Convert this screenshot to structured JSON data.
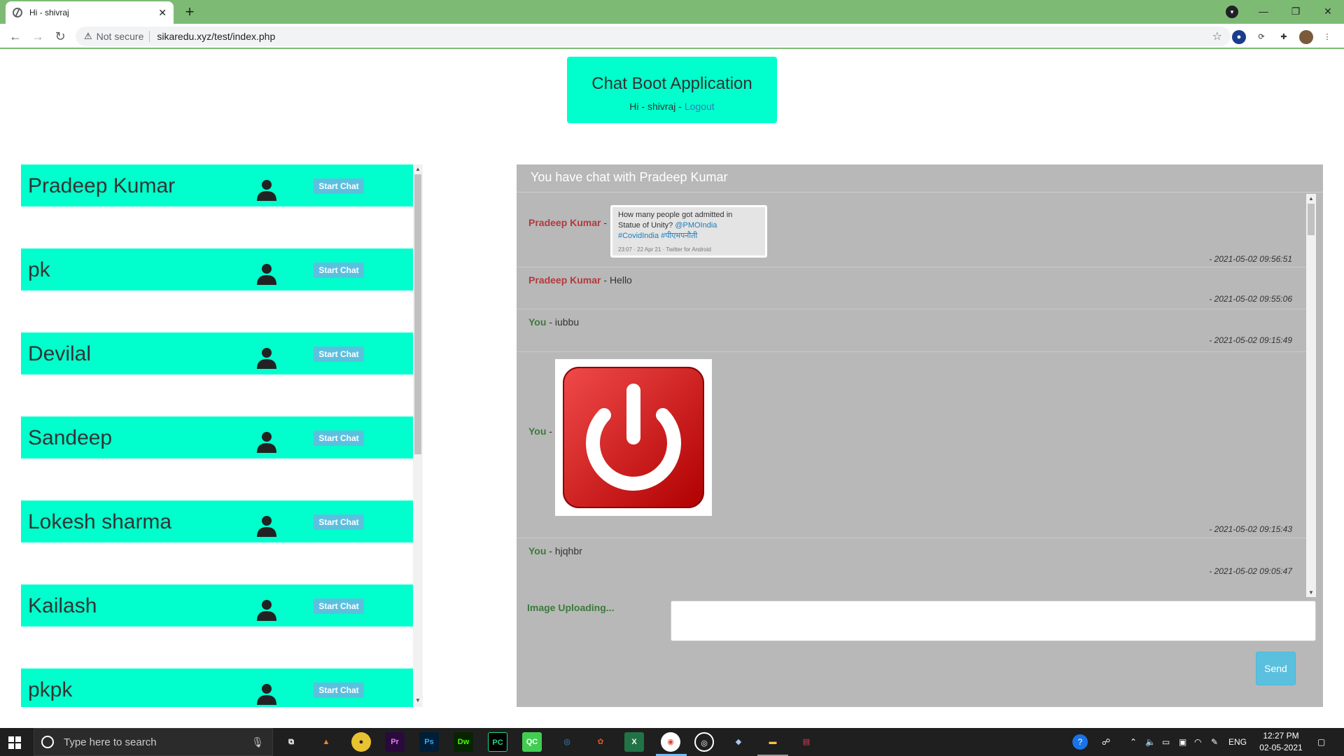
{
  "browser": {
    "tab_title": "Hi - shivraj",
    "new_tab": "+",
    "not_secure": "Not secure",
    "url": "sikaredu.xyz/test/index.php"
  },
  "page": {
    "app_title": "Chat Boot Application",
    "greeting": "Hi - shivraj - ",
    "logout": "Logout"
  },
  "users": [
    {
      "name": "Pradeep Kumar",
      "button": "Start Chat"
    },
    {
      "name": "pk",
      "button": "Start Chat"
    },
    {
      "name": "Devilal",
      "button": "Start Chat"
    },
    {
      "name": "Sandeep",
      "button": "Start Chat"
    },
    {
      "name": "Lokesh sharma",
      "button": "Start Chat"
    },
    {
      "name": "Kailash",
      "button": "Start Chat"
    },
    {
      "name": "pkpk",
      "button": "Start Chat"
    }
  ],
  "chat": {
    "header": "You have chat with Pradeep Kumar",
    "messages": [
      {
        "sender": "Pradeep Kumar",
        "sep": " - ",
        "text": "",
        "time": "- 2021-05-02 09:56:51",
        "kind": "tweet-image"
      },
      {
        "sender": "Pradeep Kumar",
        "sep": " - ",
        "text": "Hello",
        "time": "- 2021-05-02 09:55:06",
        "kind": "text"
      },
      {
        "sender": "You",
        "sep": " - ",
        "text": "iubbu",
        "time": "- 2021-05-02 09:15:49",
        "kind": "text"
      },
      {
        "sender": "You",
        "sep": " - ",
        "text": "",
        "time": "- 2021-05-02 09:15:43",
        "kind": "power-image"
      },
      {
        "sender": "You",
        "sep": " - ",
        "text": "hjqhbr",
        "time": "- 2021-05-02 09:05:47",
        "kind": "text"
      }
    ],
    "tweet": {
      "line1": "How many people got admitted in",
      "line2": "Statue of Unity? ",
      "mention": "@PMOIndia",
      "hashtags": "#CovidIndia #पीएमपनौती",
      "meta": "23:07 · 22 Apr 21 · Twitter for Android"
    },
    "upload_status": "Image Uploading...",
    "send": "Send"
  },
  "taskbar": {
    "search_placeholder": "Type here to search",
    "lang": "ENG",
    "time": "12:27 PM",
    "date": "02-05-2021"
  },
  "colors": {
    "accent": "#00ffcc",
    "chrome": "#7dbb75",
    "chat_bg": "#b8b8b8",
    "button": "#5bc0de"
  }
}
